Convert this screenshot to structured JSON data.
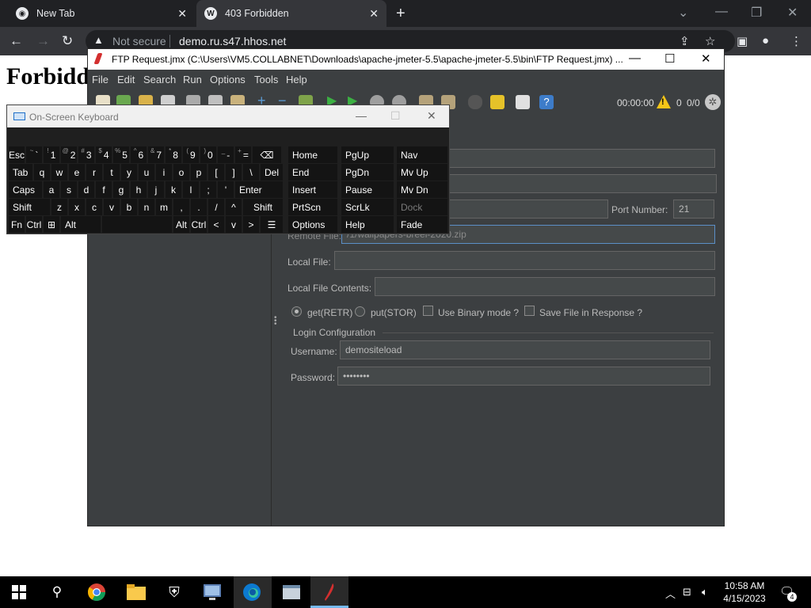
{
  "browser": {
    "tabs": [
      {
        "label": "New Tab",
        "active": false
      },
      {
        "label": "403 Forbidden",
        "active": true
      }
    ],
    "security_label": "Not secure",
    "url": "demo.ru.s47.hhos.net",
    "page_heading": "Forbidden"
  },
  "jmeter": {
    "title": "FTP Request.jmx (C:\\Users\\VM5.COLLABNET\\Downloads\\apache-jmeter-5.5\\apache-jmeter-5.5\\bin\\FTP Request.jmx) ...",
    "menu": [
      "File",
      "Edit",
      "Search",
      "Run",
      "Options",
      "Tools",
      "Help"
    ],
    "status": {
      "elapsed": "00:00:00",
      "warnings": "0",
      "threads": "0/0"
    },
    "form": {
      "port_label": "Port Number:",
      "port_value": "21",
      "remote_file_label": "Remote File:",
      "remote_file_value": "/1/wallpapers-breel-2020.zip",
      "local_file_label": "Local File:",
      "local_file_value": "",
      "local_contents_label": "Local File Contents:",
      "local_contents_value": "",
      "get_label": "get(RETR)",
      "put_label": "put(STOR)",
      "binary_label": "Use Binary mode ?",
      "save_label": "Save File in Response ?",
      "login_group": "Login Configuration",
      "username_label": "Username:",
      "username_value": "demositeload",
      "password_label": "Password:",
      "password_value": "••••••••"
    }
  },
  "osk": {
    "title": "On-Screen Keyboard",
    "row1": [
      {
        "sub": "",
        "main": "Esc"
      },
      {
        "sub": "~",
        "main": "`"
      },
      {
        "sub": "!",
        "main": "1"
      },
      {
        "sub": "@",
        "main": "2"
      },
      {
        "sub": "#",
        "main": "3"
      },
      {
        "sub": "$",
        "main": "4"
      },
      {
        "sub": "%",
        "main": "5"
      },
      {
        "sub": "^",
        "main": "6"
      },
      {
        "sub": "&",
        "main": "7"
      },
      {
        "sub": "*",
        "main": "8"
      },
      {
        "sub": "(",
        "main": "9"
      },
      {
        "sub": ")",
        "main": "0"
      },
      {
        "sub": "_",
        "main": "-"
      },
      {
        "sub": "+",
        "main": "="
      },
      {
        "sub": "",
        "main": "⌫"
      }
    ],
    "row2": [
      "Tab",
      "q",
      "w",
      "e",
      "r",
      "t",
      "y",
      "u",
      "i",
      "o",
      "p",
      "[",
      "]",
      "\\",
      "Del"
    ],
    "row3": [
      "Caps",
      "a",
      "s",
      "d",
      "f",
      "g",
      "h",
      "j",
      "k",
      "l",
      ";",
      "'",
      "Enter"
    ],
    "row4": [
      "Shift",
      "z",
      "x",
      "c",
      "v",
      "b",
      "n",
      "m",
      ",",
      ".",
      "/",
      "^",
      "Shift"
    ],
    "row5": [
      "Fn",
      "Ctrl",
      "⊞",
      "Alt",
      "Alt",
      "Ctrl",
      "<",
      "v",
      ">",
      "☰"
    ],
    "nav_col1": [
      "Home",
      "End",
      "Insert",
      "PrtScn",
      "Options"
    ],
    "nav_col2": [
      "PgUp",
      "PgDn",
      "Pause",
      "ScrLk",
      "Help"
    ],
    "nav_col3": [
      "Nav",
      "Mv Up",
      "Mv Dn",
      "Dock",
      "Fade"
    ]
  },
  "taskbar": {
    "time": "10:58 AM",
    "date": "4/15/2023",
    "notifications": "4"
  }
}
